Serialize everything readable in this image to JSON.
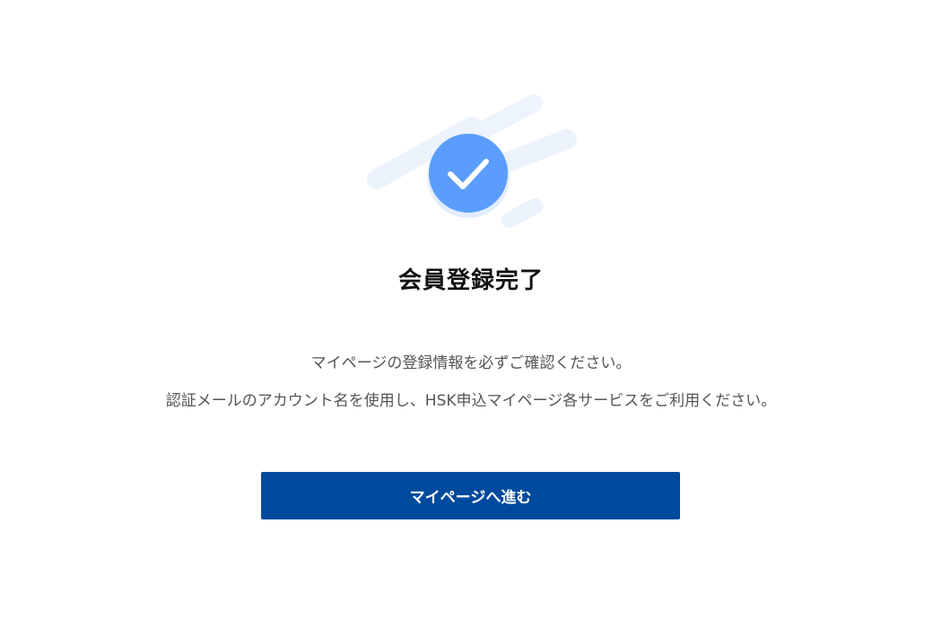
{
  "completion": {
    "title": "会員登録完了",
    "messages": [
      "マイページの登録情報を必ずご確認ください。",
      "認証メールのアカウント名を使用し、HSK申込マイページ各サービスをご利用ください。"
    ],
    "button_label": "マイページへ進む",
    "icon": "check-circle-icon"
  },
  "colors": {
    "button_background": "#004a9d",
    "check_circle": "#5b9dfc",
    "streaks": "#ecf3fd",
    "title_text": "#111111",
    "body_text": "#555555"
  }
}
